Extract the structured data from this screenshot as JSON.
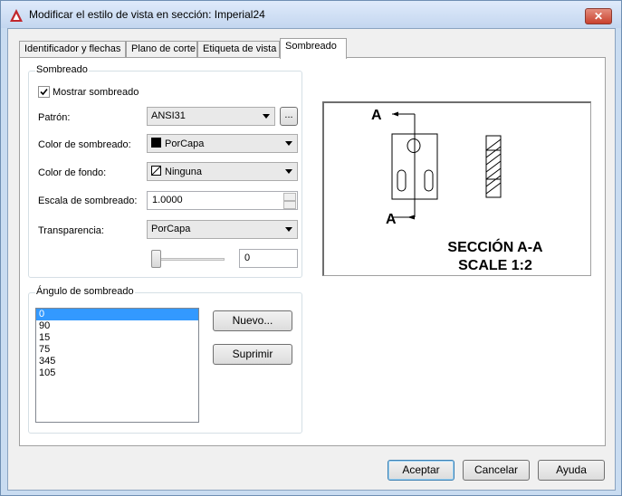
{
  "window": {
    "title": "Modificar el estilo de vista en sección: Imperial24",
    "close_glyph": "✕"
  },
  "tabs": [
    {
      "label": "Identificador y flechas"
    },
    {
      "label": "Plano de corte"
    },
    {
      "label": "Etiqueta de vista"
    },
    {
      "label": "Sombreado"
    }
  ],
  "hatch_group": {
    "title": "Sombreado",
    "show_hatch_label": "Mostrar sombreado",
    "show_hatch_checked": true,
    "pattern_label": "Patrón:",
    "pattern_value": "ANSI31",
    "browse_label": "...",
    "hatch_color_label": "Color de sombreado:",
    "hatch_color_value": "PorCapa",
    "hatch_color_swatch": "#000000",
    "background_color_label": "Color de fondo:",
    "background_color_value": "Ninguna",
    "scale_label": "Escala de sombreado:",
    "scale_value": "1.0000",
    "transparency_label": "Transparencia:",
    "transparency_value": "PorCapa",
    "transparency_amount": "0",
    "transparency_slider_level": 0
  },
  "angle_group": {
    "title": "Ángulo de sombreado",
    "angles": [
      "0",
      "90",
      "15",
      "75",
      "345",
      "105"
    ],
    "selected_index": 0,
    "new_button": "Nuevo...",
    "delete_button": "Suprimir"
  },
  "preview": {
    "section_letter_top": "A",
    "section_letter_bottom": "A",
    "caption_line1": "SECCIÓN A-A",
    "caption_line2": "SCALE 1:2"
  },
  "footer": {
    "ok": "Aceptar",
    "cancel": "Cancelar",
    "help": "Ayuda"
  },
  "colors": {
    "selection": "#3399ff",
    "titlebar": "#c9dcf1",
    "close": "#c9412e"
  }
}
